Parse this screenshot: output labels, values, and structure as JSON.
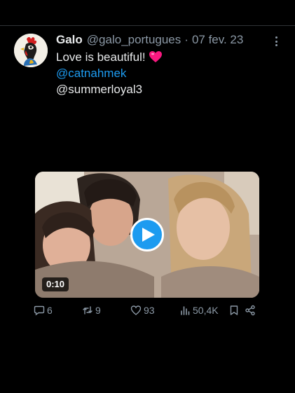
{
  "tweet": {
    "author_name": "Galo",
    "handle": "@galo_portugues",
    "separator": "·",
    "date": "07 fev. 23",
    "text": "Love is beautiful!",
    "mentions": [
      "@catnahmek",
      "@summerloyal3"
    ]
  },
  "media": {
    "duration": "0:10"
  },
  "actions": {
    "replies": "6",
    "retweets": "9",
    "likes": "93",
    "views": "50,4K"
  },
  "colors": {
    "background": "#000000",
    "text": "#e7e9ea",
    "secondary": "#8b98a5",
    "link": "#1d9bf0",
    "play": "#1d9bf0",
    "heart": "#f91880"
  }
}
